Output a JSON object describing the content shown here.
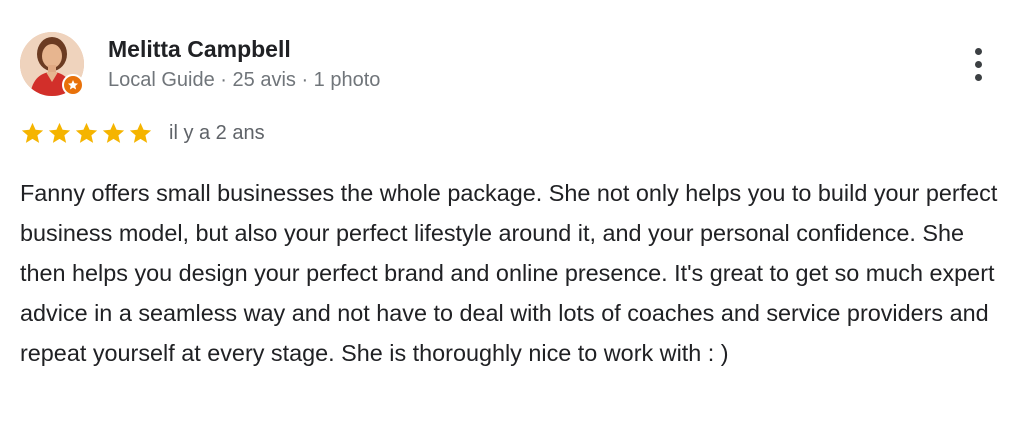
{
  "review": {
    "author": {
      "name": "Melitta Campbell",
      "meta": "Local Guide · 25 avis · 1 photo",
      "badge_icon": "local-guide-star-icon",
      "badge_color": "#e8710a"
    },
    "rating": {
      "stars": 5,
      "max_stars": 5,
      "star_color": "#f5b400",
      "date": "il y a 2 ans"
    },
    "text": "Fanny offers small businesses the whole package. She not only helps you to build your perfect business model, but also your perfect lifestyle around it, and your personal confidence. She then helps you design your perfect brand and online presence. It's great to get so much expert advice in a seamless way and not have to deal with lots of coaches and service providers and repeat yourself at every stage. She is thoroughly nice to work with : )",
    "menu_icon": "more-vert-icon"
  }
}
